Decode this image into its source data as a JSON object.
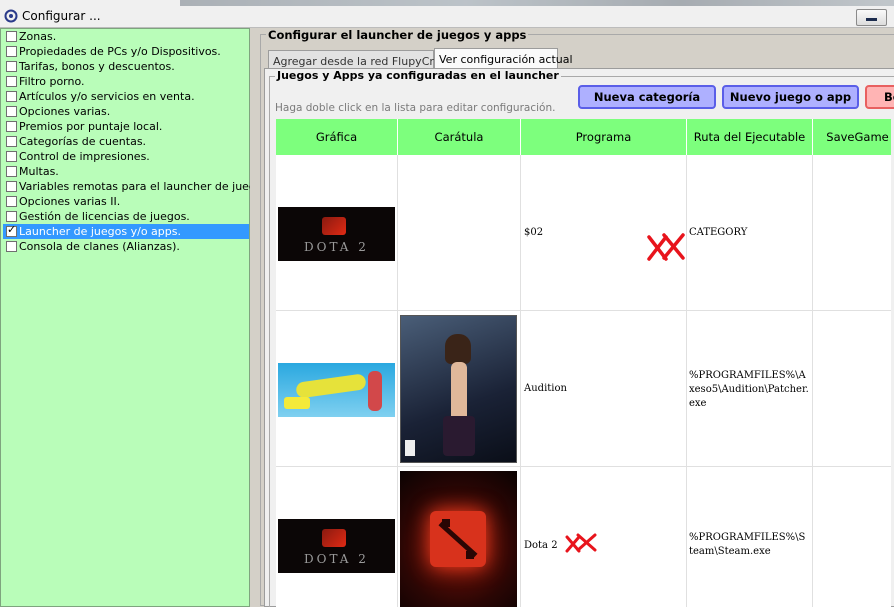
{
  "window": {
    "title": "Configurar ..."
  },
  "sidebar": {
    "items": [
      {
        "label": "Zonas.",
        "checked": false
      },
      {
        "label": "Propiedades de PCs y/o Dispositivos.",
        "checked": false
      },
      {
        "label": "Tarifas, bonos y descuentos.",
        "checked": false
      },
      {
        "label": "Filtro porno.",
        "checked": false
      },
      {
        "label": "Artículos y/o servicios en venta.",
        "checked": false
      },
      {
        "label": "Opciones varias.",
        "checked": false
      },
      {
        "label": "Premios por puntaje local.",
        "checked": false
      },
      {
        "label": "Categorías de cuentas.",
        "checked": false
      },
      {
        "label": "Control de impresiones.",
        "checked": false
      },
      {
        "label": "Multas.",
        "checked": false
      },
      {
        "label": "Variables remotas para el launcher de juegos.",
        "checked": false
      },
      {
        "label": "Opciones varias II.",
        "checked": false
      },
      {
        "label": "Gestión de licencias de juegos.",
        "checked": false
      },
      {
        "label": "Launcher de juegos y/o apps.",
        "checked": true,
        "selected": true
      },
      {
        "label": "Consola de clanes (Alianzas).",
        "checked": false
      }
    ]
  },
  "main": {
    "section_title": "Configurar el launcher de juegos y apps",
    "tabs": [
      {
        "label": "Agregar desde la red FlupyCrea®"
      },
      {
        "label": "Ver configuración actual"
      }
    ],
    "group_title": "Juegos y Apps ya configuradas en el launcher",
    "hint": "Haga doble click en la lista para editar configuración.",
    "buttons": {
      "new_category": "Nueva categoría",
      "new_game": "Nuevo juego o app",
      "third": "Bo"
    },
    "table": {
      "columns": [
        "Gráfica",
        "Carátula",
        "Programa",
        "Ruta del Ejecutable",
        "SaveGame"
      ],
      "rows": [
        {
          "grafica": "DOTA 2 banner",
          "caratula": "",
          "programa": "$02",
          "ruta": "CATEGORY"
        },
        {
          "grafica": "Audition banner",
          "caratula": "Audition cover",
          "programa": "Audition",
          "ruta": "%PROGRAMFILES%\\Axeso5\\Audition\\Patcher.exe"
        },
        {
          "grafica": "DOTA 2 banner",
          "caratula": "Dota 2 cover",
          "programa": "Dota 2",
          "ruta": "%PROGRAMFILES%\\Steam\\Steam.exe"
        }
      ]
    }
  },
  "colors": {
    "sidebar_bg": "#b9fdb9",
    "header_bg": "#7dff7d",
    "selection": "#3399ff",
    "button_blue": "#aeb0ff",
    "button_red": "#ffb4b4",
    "x_mark": "#e8141c"
  }
}
